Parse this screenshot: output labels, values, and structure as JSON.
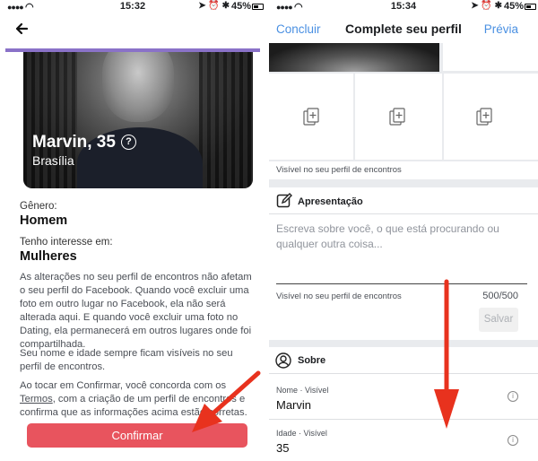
{
  "left": {
    "status": {
      "time": "15:32",
      "battery": "45%"
    },
    "profile": {
      "name_age": "Marvin, 35",
      "city": "Brasília",
      "help_icon": "?"
    },
    "gender_label": "Gênero:",
    "gender_value": "Homem",
    "interest_label": "Tenho interesse em:",
    "interest_value": "Mulheres",
    "paragraph1": "As alterações no seu perfil de encontros não afetam o seu perfil do Facebook. Quando você excluir uma foto em outro lugar no Facebook, ela não será alterada aqui. E quando você excluir uma foto no Dating, ela permanecerá em outros lugares onde foi compartilhada.",
    "paragraph2": "Seu nome e idade sempre ficam visíveis no seu perfil de encontros.",
    "paragraph3_before": "Ao tocar em Confirmar, você concorda com os ",
    "paragraph3_link": "Termos",
    "paragraph3_after": ", com a criação de um perfil de encontros e confirma que as informações acima estão corretas.",
    "confirm_button": "Confirmar"
  },
  "right": {
    "status": {
      "time": "15:34",
      "battery": "45%"
    },
    "nav": {
      "left": "Concluir",
      "title": "Complete seu perfil",
      "right": "Prévia"
    },
    "photos_visible_note": "Visível no seu perfil de encontros",
    "intro_section": "Apresentação",
    "intro_placeholder": "Escreva sobre você, o que está procurando ou qualquer outra coisa...",
    "intro_visible_note": "Visível no seu perfil de encontros",
    "intro_counter": "500/500",
    "save_button": "Salvar",
    "about_section": "Sobre",
    "name_label": "Nome · Visível",
    "name_value": "Marvin",
    "age_label": "Idade · Visível",
    "age_value": "35"
  },
  "colors": {
    "accent_blue": "#4a90e2",
    "confirm_red": "#e8545e",
    "purple_bar": "#8a72c8",
    "arrow_red": "#e8321e"
  },
  "icons": [
    "back-arrow-icon",
    "add-photo-icon",
    "edit-icon",
    "person-icon",
    "info-icon",
    "help-icon"
  ]
}
